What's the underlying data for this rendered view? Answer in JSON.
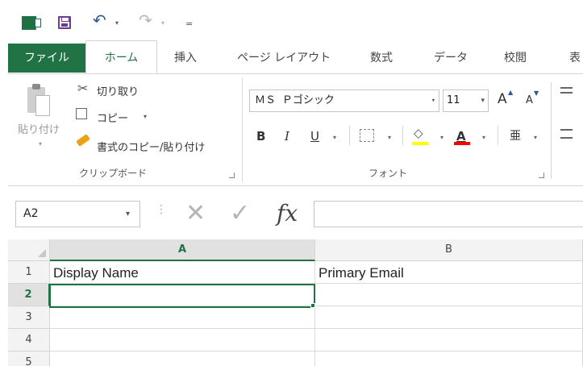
{
  "quick_access": {
    "app_logo": "X",
    "undo_glyph": "↶",
    "redo_glyph": "↷",
    "dropdown_glyph": "▾",
    "customize_glyph": "="
  },
  "tabs": {
    "file": "ファイル",
    "home": "ホーム",
    "insert": "挿入",
    "page_layout": "ページ レイアウト",
    "formulas": "数式",
    "data": "データ",
    "review": "校閲",
    "view_partial": "表"
  },
  "clipboard": {
    "paste": "貼り付け",
    "cut": "切り取り",
    "copy": "コピー",
    "format_painter": "書式のコピー/貼り付け",
    "group_label": "クリップボード"
  },
  "font": {
    "name": "ＭＳ Ｐゴシック",
    "size": "11",
    "grow": "A",
    "shrink": "A",
    "bold": "B",
    "italic": "I",
    "underline": "U",
    "phonetic": "亜",
    "group_label": "フォント",
    "fill_color": "#ffff00",
    "font_color": "#ff0000"
  },
  "formula_bar": {
    "name_box": "A2",
    "cancel_glyph": "✕",
    "enter_glyph": "✓",
    "fx_label": "fx",
    "content": ""
  },
  "grid": {
    "columns": [
      "A",
      "B"
    ],
    "rows": [
      "1",
      "2",
      "3",
      "4",
      "5"
    ],
    "cells": {
      "A1": "Display Name",
      "B1": "Primary Email"
    },
    "selected_cell": "A2"
  },
  "colors": {
    "excel_green": "#217346",
    "save_purple": "#6b3d91"
  }
}
